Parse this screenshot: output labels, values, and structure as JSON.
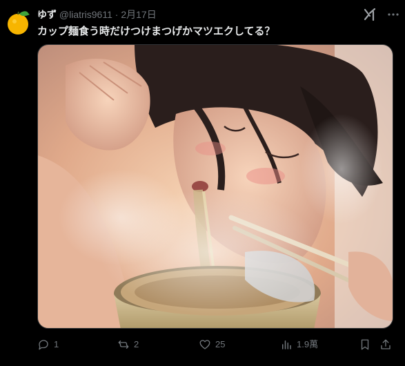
{
  "author": {
    "name": "ゆず",
    "handle": "@liatris9611",
    "separator": "·",
    "date": "2月17日",
    "avatar_icon": "yuzu-fruit-icon",
    "avatar_color": "#f7b500"
  },
  "tweet": {
    "text": "カップ麺食う時だけつけまつげかマツエクしてる？",
    "media_description_icon": "illustration-image"
  },
  "actions": {
    "reply_count": "1",
    "repost_count": "2",
    "like_count": "25",
    "views_count": "1.9萬"
  },
  "colors": {
    "background": "#000000",
    "text_primary": "#e7e9ea",
    "text_secondary": "#71767b"
  }
}
